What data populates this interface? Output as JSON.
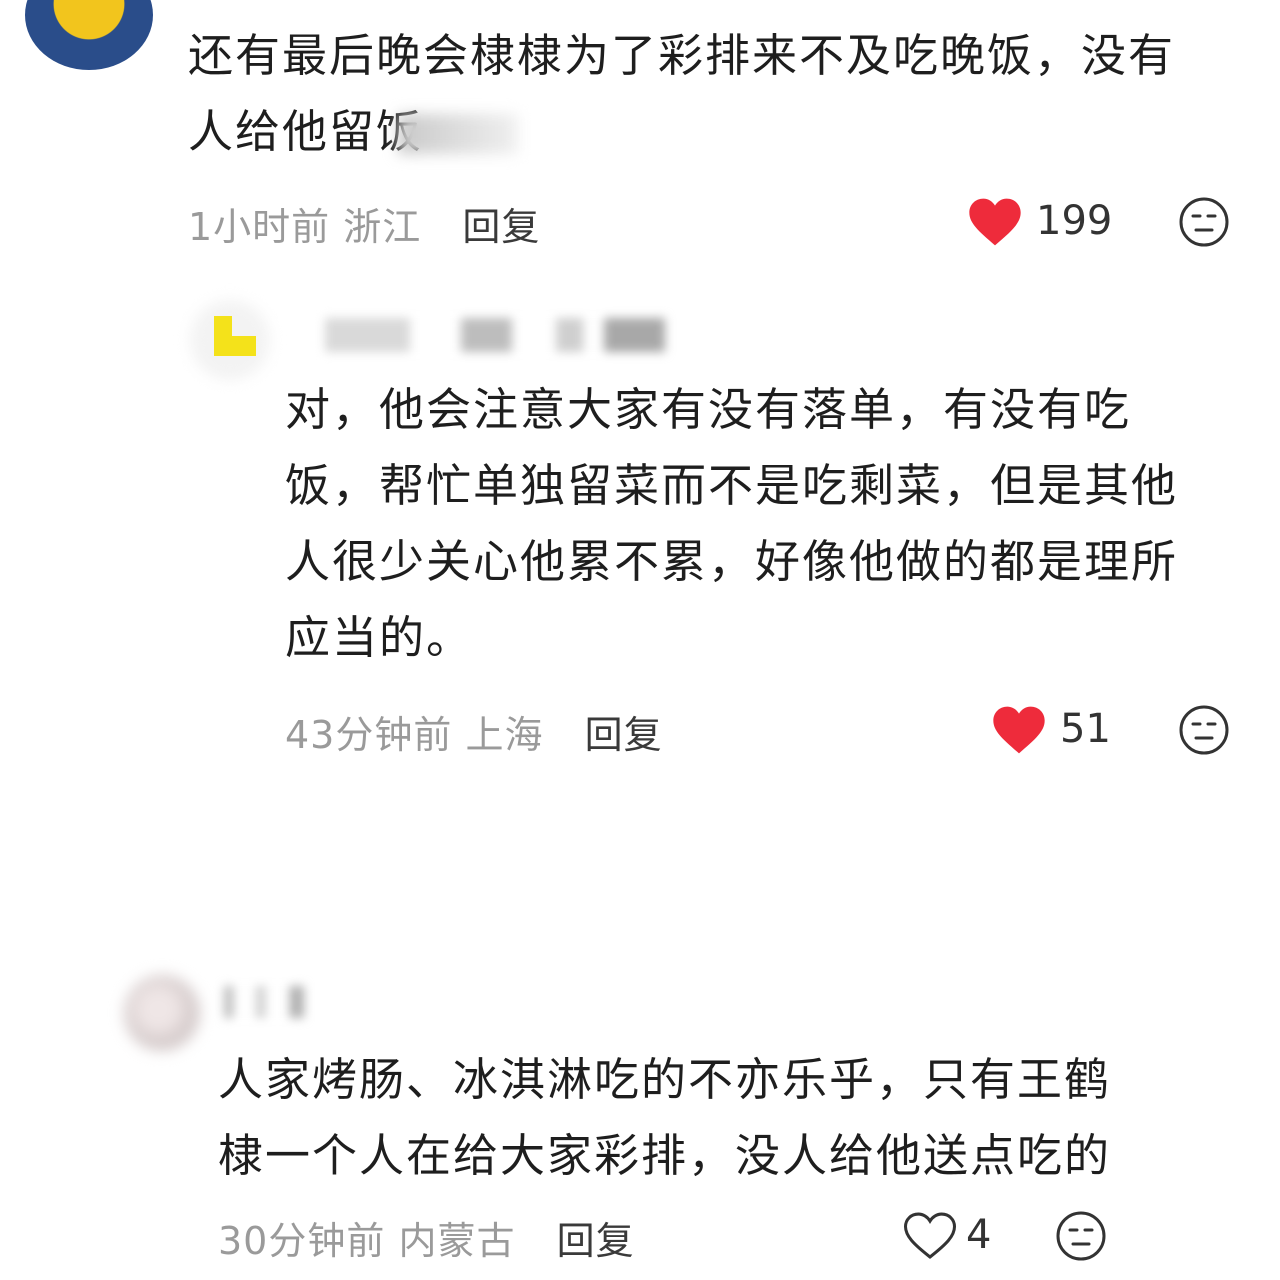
{
  "colors": {
    "like_active": "#ee2b3b",
    "meta_text": "#9a9a9a",
    "body_text": "#1e1e1e"
  },
  "comments": [
    {
      "text_lines": [
        "还有最后晚会棣棣为了彩排来不及吃晚饭，没有",
        "人给他留饭"
      ],
      "time": "1小时前",
      "location": "浙江",
      "reply_label": "回复",
      "likes": "199",
      "liked": true,
      "like_icon": "heart-filled-icon",
      "react_icon": "neutral-face-icon"
    },
    {
      "text_lines": [
        "对，他会注意大家有没有落单，有没有吃",
        "饭，帮忙单独留菜而不是吃剩菜，但是其他",
        "人很少关心他累不累，好像他做的都是理所",
        "应当的。"
      ],
      "time": "43分钟前",
      "location": "上海",
      "reply_label": "回复",
      "likes": "51",
      "liked": true,
      "like_icon": "heart-filled-icon",
      "react_icon": "neutral-face-icon"
    },
    {
      "text_lines": [
        "人家烤肠、冰淇淋吃的不亦乐乎，只有王鹤",
        "棣一个人在给大家彩排，没人给他送点吃的"
      ],
      "time": "30分钟前",
      "location": "内蒙古",
      "reply_label": "回复",
      "likes": "4",
      "liked": false,
      "like_icon": "heart-outline-icon",
      "react_icon": "neutral-face-icon"
    }
  ]
}
